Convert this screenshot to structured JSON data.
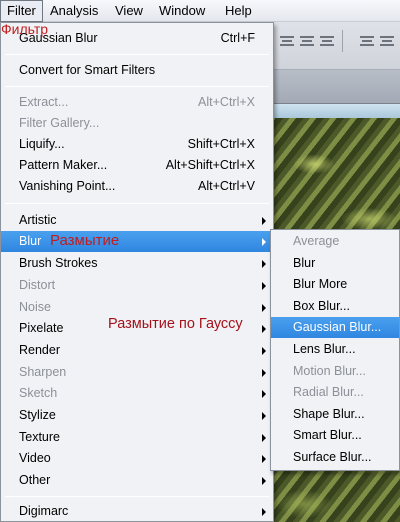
{
  "menubar": {
    "items": [
      "Filter",
      "Analysis",
      "View",
      "Window",
      "Help"
    ]
  },
  "filter_menu": {
    "last_filter": {
      "label": "Gaussian Blur",
      "shortcut": "Ctrl+F"
    },
    "convert": {
      "label": "Convert for Smart Filters"
    },
    "tools": [
      {
        "label": "Extract...",
        "shortcut": "Alt+Ctrl+X",
        "disabled": true
      },
      {
        "label": "Filter Gallery...",
        "shortcut": "",
        "disabled": true
      },
      {
        "label": "Liquify...",
        "shortcut": "Shift+Ctrl+X",
        "disabled": false
      },
      {
        "label": "Pattern Maker...",
        "shortcut": "Alt+Shift+Ctrl+X",
        "disabled": false
      },
      {
        "label": "Vanishing Point...",
        "shortcut": "Alt+Ctrl+V",
        "disabled": false
      }
    ],
    "categories": [
      {
        "label": "Artistic",
        "disabled": false
      },
      {
        "label": "Blur",
        "disabled": false,
        "highlighted": true
      },
      {
        "label": "Brush Strokes",
        "disabled": false
      },
      {
        "label": "Distort",
        "disabled": true
      },
      {
        "label": "Noise",
        "disabled": true
      },
      {
        "label": "Pixelate",
        "disabled": false
      },
      {
        "label": "Render",
        "disabled": false
      },
      {
        "label": "Sharpen",
        "disabled": true
      },
      {
        "label": "Sketch",
        "disabled": true
      },
      {
        "label": "Stylize",
        "disabled": false
      },
      {
        "label": "Texture",
        "disabled": false
      },
      {
        "label": "Video",
        "disabled": false
      },
      {
        "label": "Other",
        "disabled": false
      }
    ],
    "plugins": [
      {
        "label": "Digimarc",
        "disabled": false
      }
    ]
  },
  "blur_submenu": {
    "items": [
      {
        "label": "Average",
        "disabled": true
      },
      {
        "label": "Blur",
        "disabled": false
      },
      {
        "label": "Blur More",
        "disabled": false
      },
      {
        "label": "Box Blur...",
        "disabled": false
      },
      {
        "label": "Gaussian Blur...",
        "disabled": false,
        "highlighted": true
      },
      {
        "label": "Lens Blur...",
        "disabled": false
      },
      {
        "label": "Motion Blur...",
        "disabled": true
      },
      {
        "label": "Radial Blur...",
        "disabled": true
      },
      {
        "label": "Shape Blur...",
        "disabled": false
      },
      {
        "label": "Smart Blur...",
        "disabled": false
      },
      {
        "label": "Surface Blur...",
        "disabled": false
      }
    ]
  },
  "annotations": {
    "filter": "Фильтр",
    "blur": "Размытие",
    "gaussian": "Размытие по Гауссу"
  },
  "colors": {
    "highlight": "#3b8fe6",
    "annotation_red": "#c01f1f",
    "disabled_text": "#8c9098"
  },
  "icons": [
    "align-left-icon",
    "align-center-icon",
    "align-right-icon",
    "submenu-arrow-icon"
  ]
}
